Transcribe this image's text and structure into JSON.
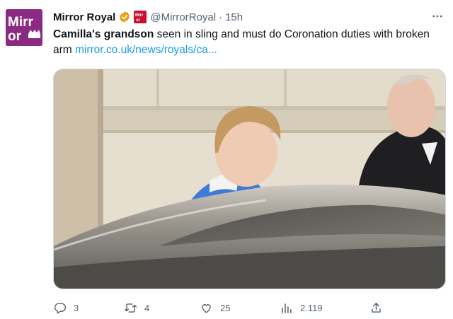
{
  "tweet": {
    "author_name": "Mirror Royal",
    "handle": "@MirrorRoyal",
    "separator": "·",
    "time": "15h",
    "text_bold": "Camilla's grandson",
    "text_rest": " seen in sling and must do Coronation duties with broken arm ",
    "link": "mirror.co.uk/news/royals/ca..."
  },
  "avatar": {
    "logo_text_top": "Mirr",
    "logo_text_bottom": "or",
    "bg": "#8b2a82"
  },
  "actions": {
    "reply_count": "3",
    "retweet_count": "4",
    "like_count": "25",
    "views_count": "2.119"
  },
  "colors": {
    "link": "#1d9bf0",
    "secondary": "#536471",
    "verified": "#e8a317",
    "affiliate": "#c8102e"
  },
  "icons": [
    "verified-badge-icon",
    "affiliate-badge-icon",
    "more-icon",
    "reply-icon",
    "retweet-icon",
    "like-icon",
    "views-icon",
    "share-icon"
  ]
}
